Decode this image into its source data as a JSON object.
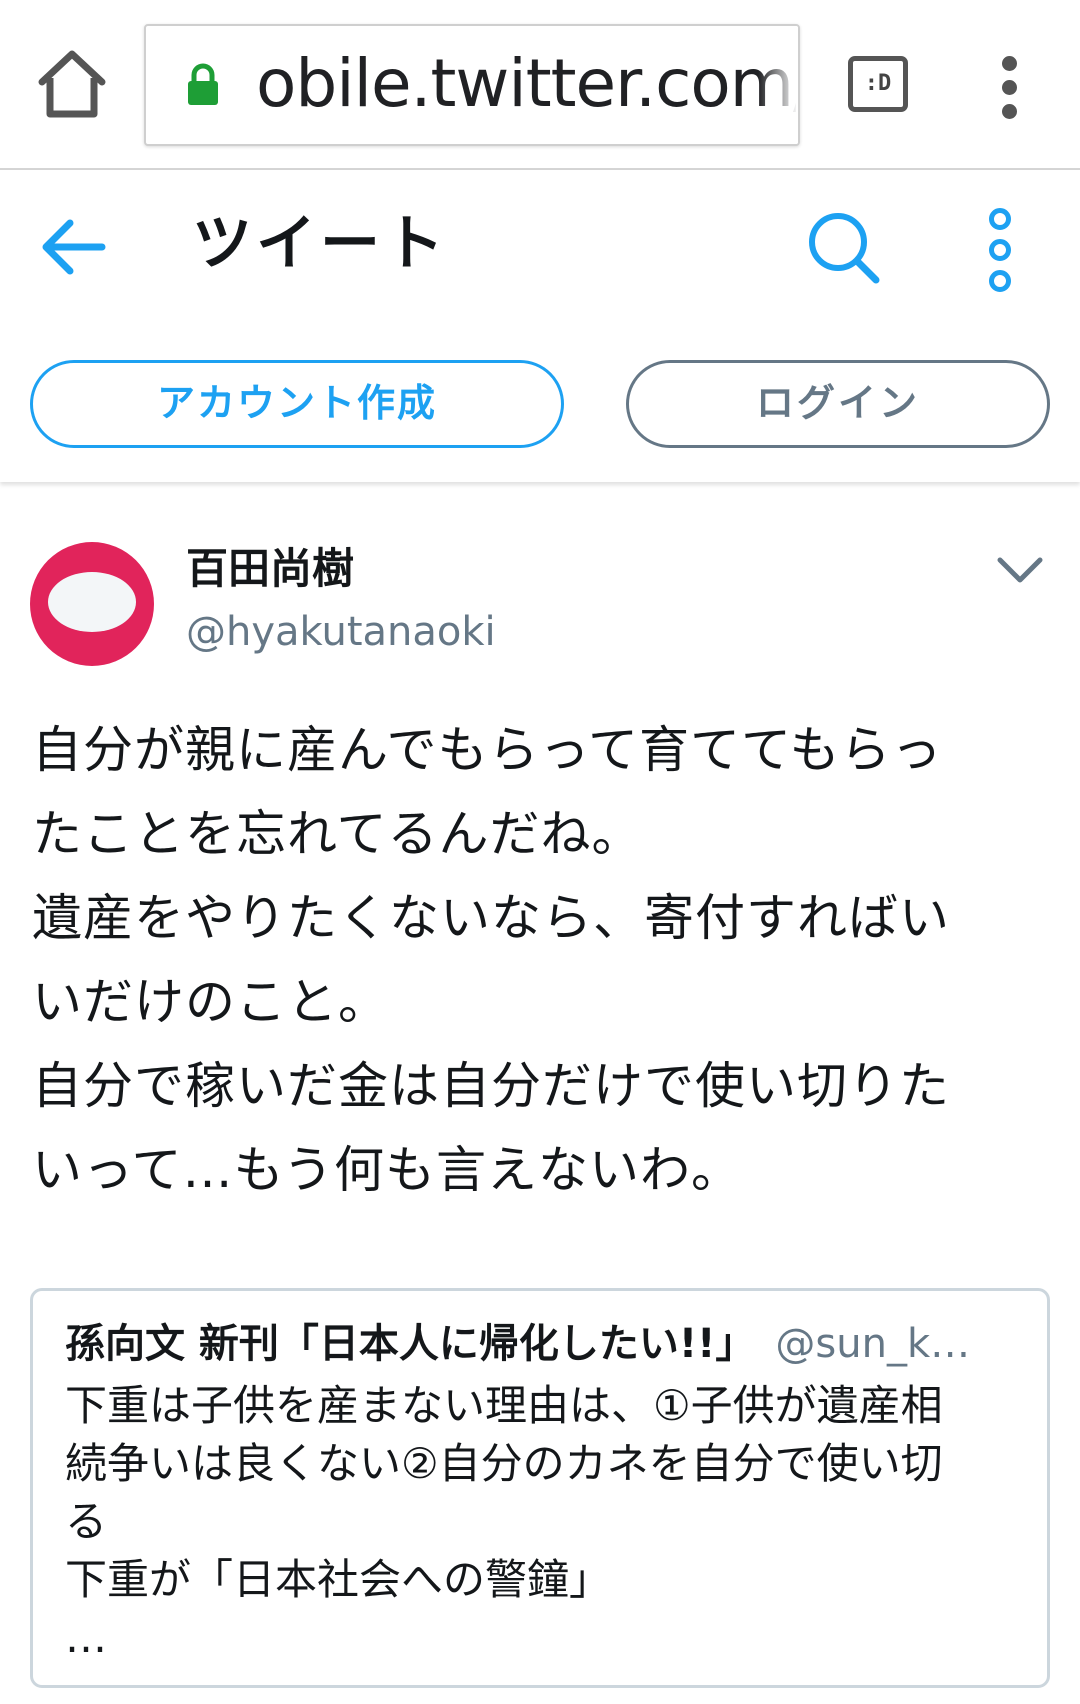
{
  "browser": {
    "url": "obile.twitter.com/h",
    "tabs_label": ":D",
    "home_icon": "home-icon",
    "lock_icon": "lock-icon",
    "menu_icon": "vertical-dots-icon"
  },
  "header": {
    "title": "ツイート",
    "back_icon": "arrow-left-icon",
    "search_icon": "search-icon",
    "more_icon": "vertical-dots-icon",
    "signup_label": "アカウント作成",
    "login_label": "ログイン"
  },
  "tweet": {
    "author_name": "百田尚樹",
    "author_handle": "@hyakutanaoki",
    "text": "自分が親に産んでもらって育ててもらっ\nたことを忘れてるんだね。\n遺産をやりたくないなら、寄付すればい\nいだけのこと。\n自分で稼いだ金は自分だけで使い切りた\nいって…もう何も言えないわ。"
  },
  "quote": {
    "author_name": "孫向文 新刊「日本人に帰化したい!!」",
    "author_handle": "@sun_k…",
    "text": "下重は子供を産まない理由は、①子供が遺産相\n続争いは良くない②自分のカネを自分で使い切\nる\n下重が「日本社会への警鐘」\n…"
  },
  "colors": {
    "accent": "#1da1f2",
    "secondary_text": "#657786",
    "avatar": "#e1245b"
  }
}
